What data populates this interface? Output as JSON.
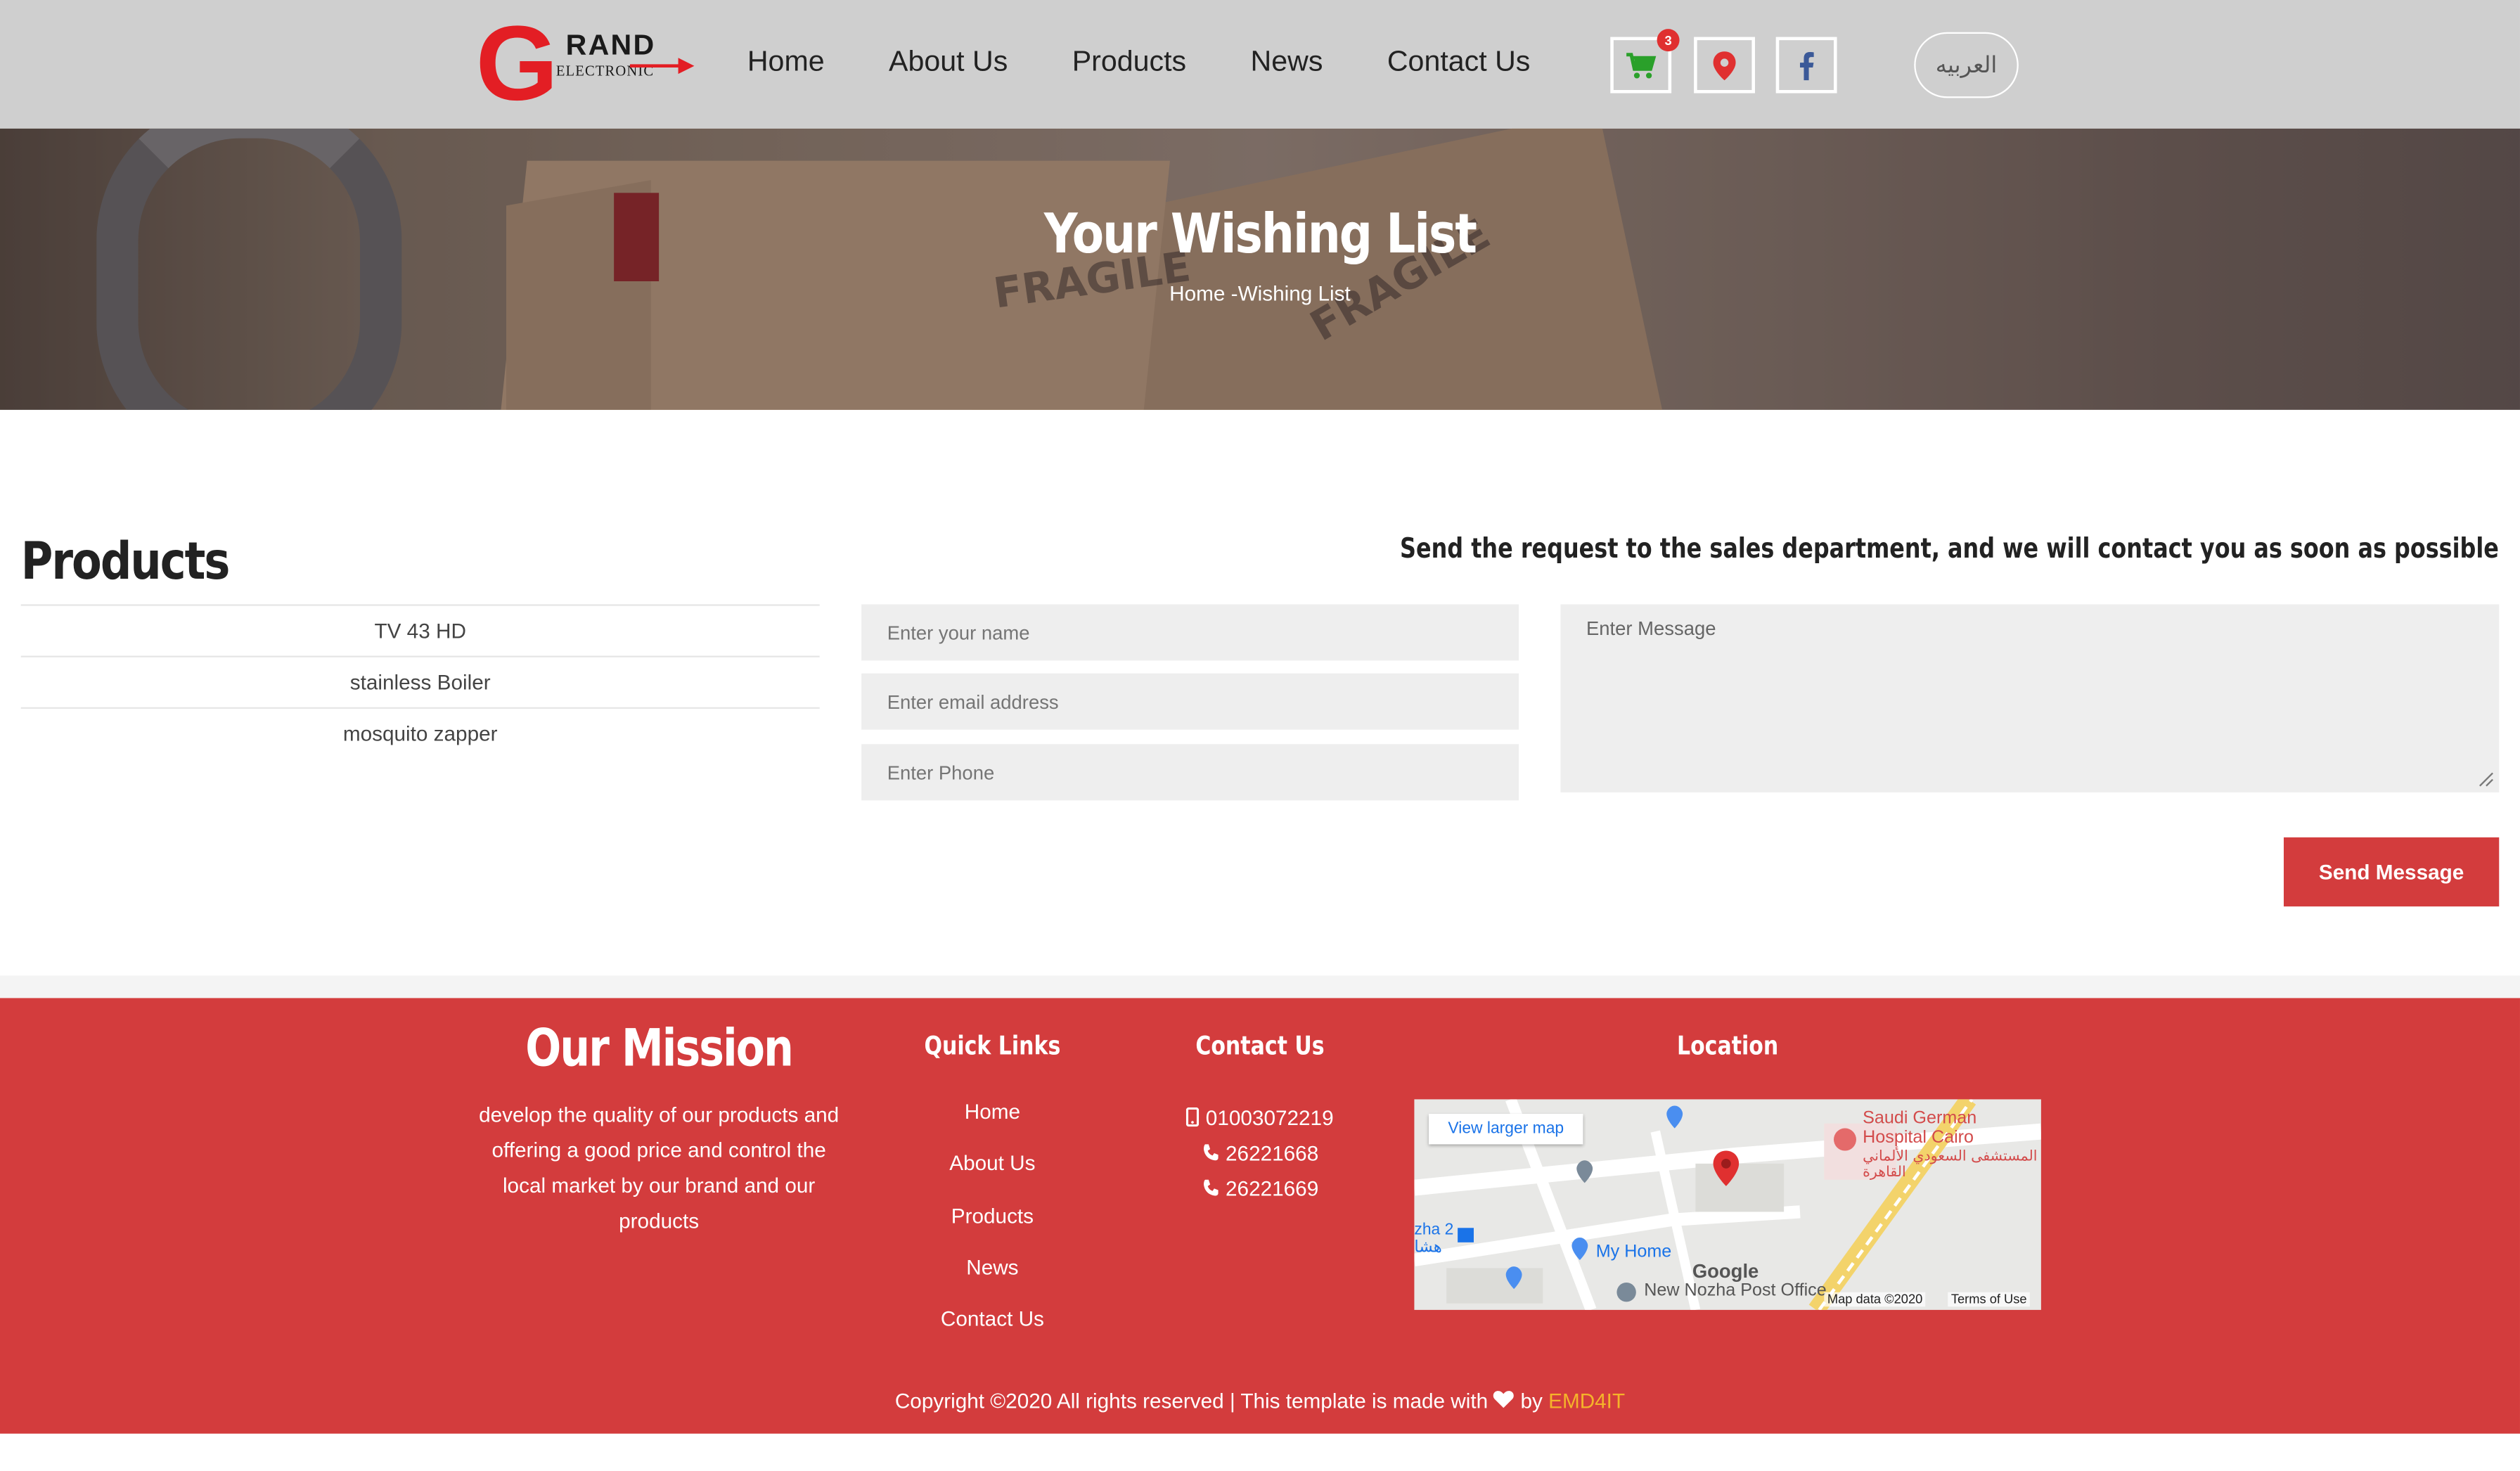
{
  "brand": {
    "logo_letter": "G",
    "logo_word": "RAND",
    "logo_sub": "ELECTRONIC",
    "red": "#e31e24"
  },
  "nav": [
    "Home",
    "About Us",
    "Products",
    "News",
    "Contact Us"
  ],
  "header_icons": {
    "cart_icon": "cart-icon",
    "cart_count": "3",
    "location_icon": "map-pin-icon",
    "facebook_icon": "facebook-icon"
  },
  "lang_button": "العربيه",
  "hero": {
    "title": "Your Wishing List",
    "breadcrumb": "Home -Wishing List",
    "image_text": [
      "FRAGILE",
      "FRAGILE"
    ]
  },
  "products": {
    "title": "Products",
    "items": [
      "TV 43 HD",
      "stainless Boiler",
      "mosquito zapper"
    ]
  },
  "form": {
    "name_placeholder": "Enter your name",
    "email_placeholder": "Enter email address",
    "phone_placeholder": "Enter Phone",
    "message_placeholder": "Enter Message",
    "request_heading": "Send the request to the sales department, and we will contact you as soon as possible",
    "send_label": "Send Message"
  },
  "footer": {
    "mission_title": "Our Mission",
    "mission_text": "develop the quality of our products and offering a good price and control the local market by our brand and our products",
    "quick_links_title": "Quick Links",
    "quick_links": [
      "Home",
      "About Us",
      "Products",
      "News",
      "Contact Us"
    ],
    "contact_title": "Contact Us",
    "phones": [
      "01003072219",
      "26221668",
      "26221669"
    ],
    "location_title": "Location",
    "map": {
      "view_larger": "View larger map",
      "hospital": "Saudi German Hospital Cairo",
      "hospital_ar": "المستشفى السعودي الألماني القاهرة",
      "my_home": "My Home",
      "post_office": "New Nozha Post Office",
      "nozha": "zha 2",
      "nozha_ar": "هشا",
      "google": "Google",
      "map_data": "Map data ©2020",
      "terms": "Terms of Use"
    },
    "copyright_prefix": "Copyright ©2020 All rights reserved | This template is made with",
    "copyright_by": "by",
    "copyright_brand": "EMD4IT",
    "accent": "#d33c3d"
  }
}
